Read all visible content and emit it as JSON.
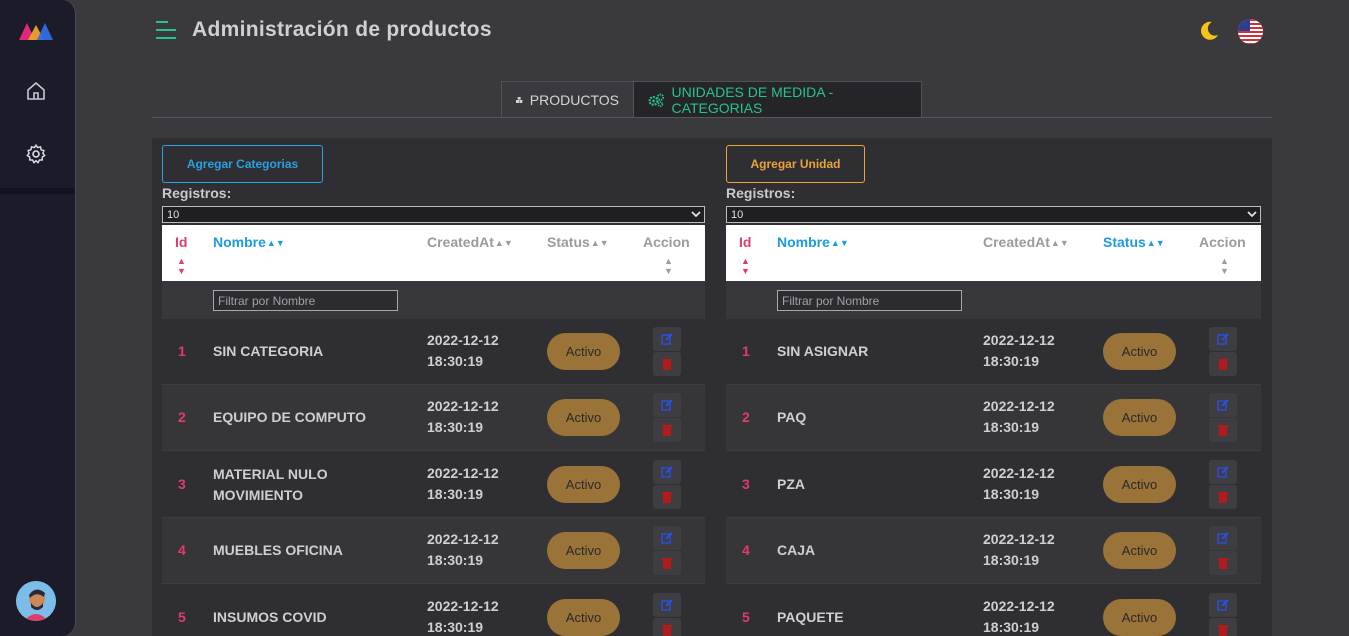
{
  "header": {
    "title": "Administración de productos"
  },
  "tabs": [
    {
      "label": "PRODUCTOS",
      "active": false
    },
    {
      "label": "UNIDADES DE MEDIDA - CATEGORIAS",
      "active": true
    }
  ],
  "colors": {
    "accent_green": "#26c48c",
    "accent_blue": "#2aa1e0",
    "accent_orange": "#e8a33a",
    "id_pink": "#e03b6b",
    "status_bg": "#9a7338"
  },
  "categories": {
    "add_button": "Agregar Categorias",
    "registros_label": "Registros:",
    "page_size": "10",
    "columns": {
      "id": "Id",
      "name": "Nombre",
      "created": "CreatedAt",
      "status": "Status",
      "action": "Accion"
    },
    "filter_placeholder": "Filtrar por Nombre",
    "rows": [
      {
        "id": "1",
        "name": "SIN CATEGORIA",
        "date": "2022-12-12",
        "time": "18:30:19",
        "status": "Activo"
      },
      {
        "id": "2",
        "name": "EQUIPO DE COMPUTO",
        "date": "2022-12-12",
        "time": "18:30:19",
        "status": "Activo"
      },
      {
        "id": "3",
        "name": "MATERIAL NULO MOVIMIENTO",
        "date": "2022-12-12",
        "time": "18:30:19",
        "status": "Activo"
      },
      {
        "id": "4",
        "name": "MUEBLES OFICINA",
        "date": "2022-12-12",
        "time": "18:30:19",
        "status": "Activo"
      },
      {
        "id": "5",
        "name": "INSUMOS COVID",
        "date": "2022-12-12",
        "time": "18:30:19",
        "status": "Activo"
      }
    ]
  },
  "units": {
    "add_button": "Agregar Unidad",
    "registros_label": "Registros:",
    "page_size": "10",
    "columns": {
      "id": "Id",
      "name": "Nombre",
      "created": "CreatedAt",
      "status": "Status",
      "action": "Accion"
    },
    "filter_placeholder": "Filtrar por Nombre",
    "rows": [
      {
        "id": "1",
        "name": "SIN ASIGNAR",
        "date": "2022-12-12",
        "time": "18:30:19",
        "status": "Activo"
      },
      {
        "id": "2",
        "name": "PAQ",
        "date": "2022-12-12",
        "time": "18:30:19",
        "status": "Activo"
      },
      {
        "id": "3",
        "name": "PZA",
        "date": "2022-12-12",
        "time": "18:30:19",
        "status": "Activo"
      },
      {
        "id": "4",
        "name": "CAJA",
        "date": "2022-12-12",
        "time": "18:30:19",
        "status": "Activo"
      },
      {
        "id": "5",
        "name": "PAQUETE",
        "date": "2022-12-12",
        "time": "18:30:19",
        "status": "Activo"
      }
    ]
  }
}
